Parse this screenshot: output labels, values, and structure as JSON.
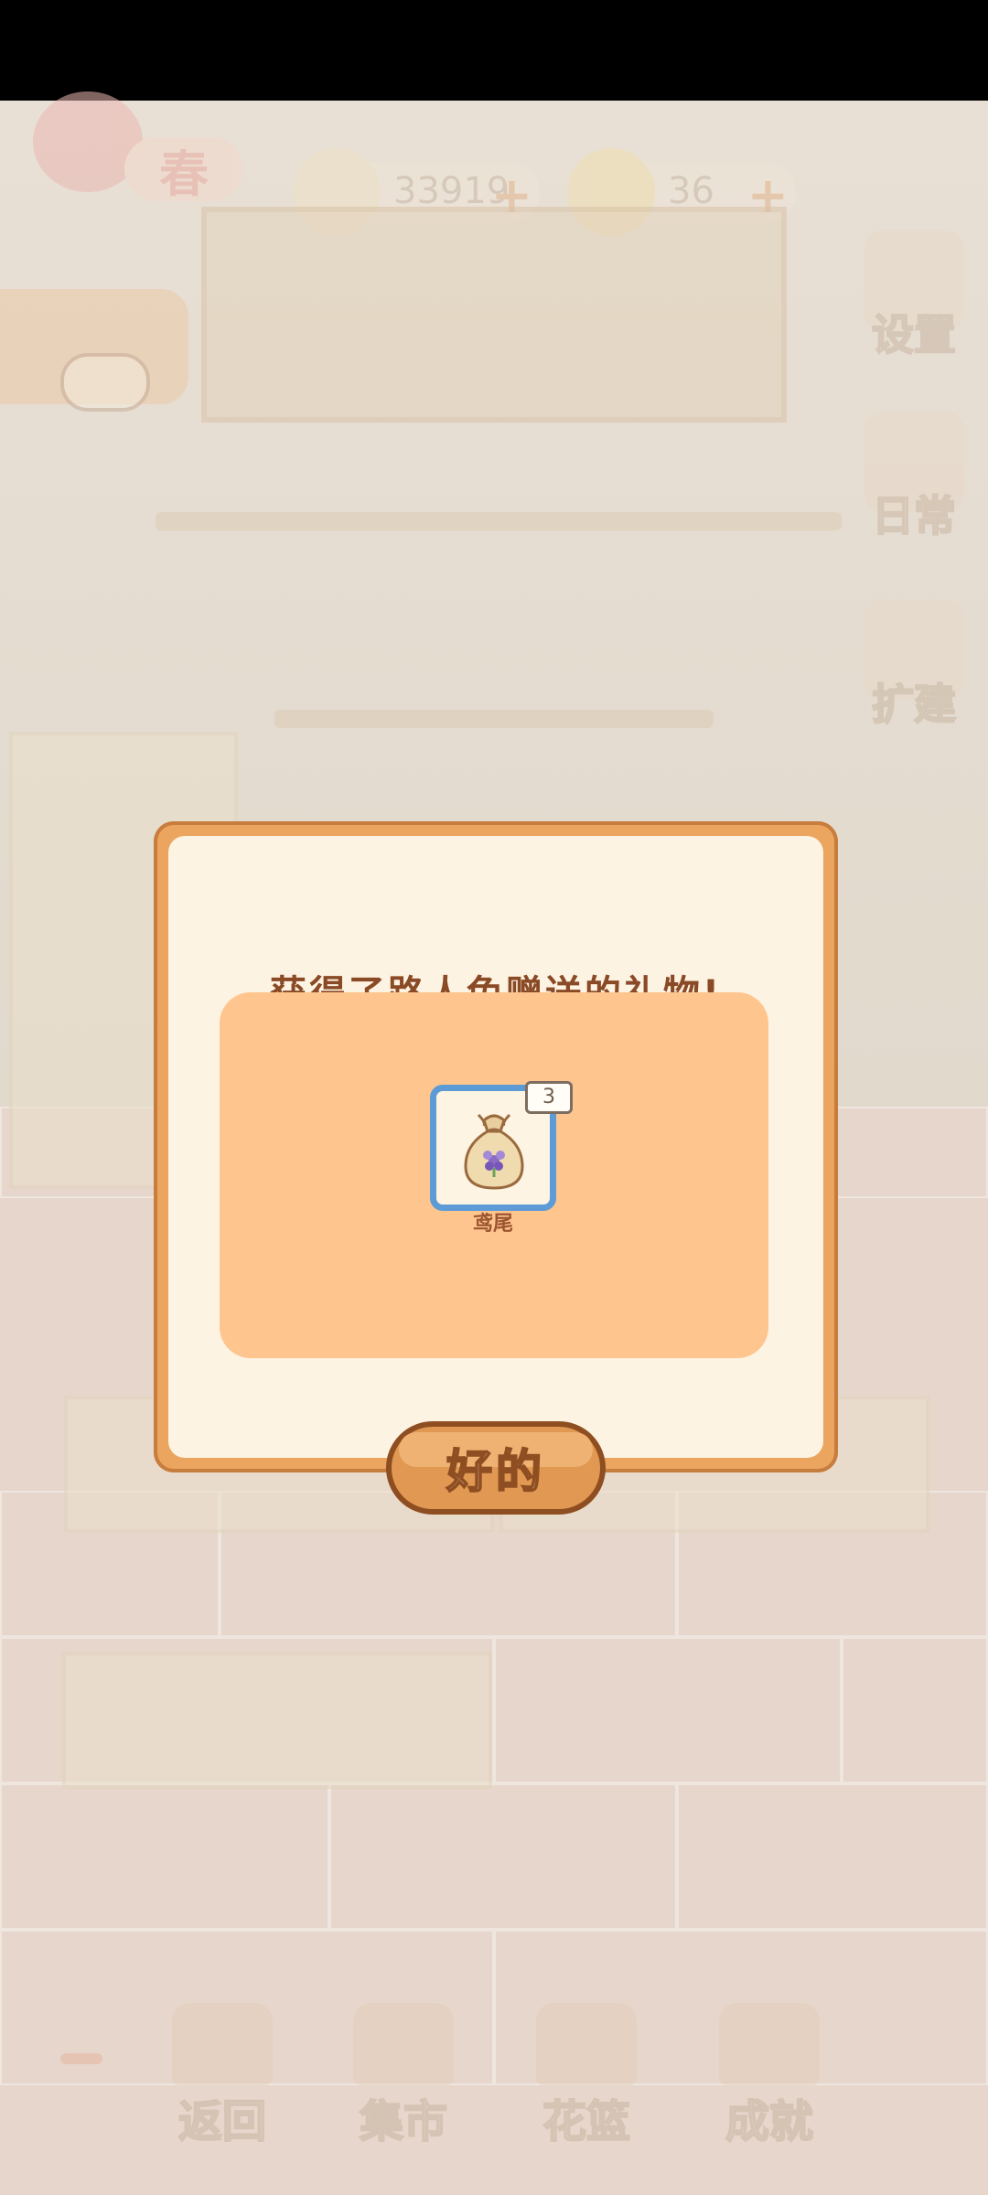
{
  "season": {
    "label": "春"
  },
  "currency": {
    "fish": {
      "value": "33919",
      "icon": "fish-bone-icon"
    },
    "cheese": {
      "value": "36",
      "icon": "cheese-icon"
    }
  },
  "side_buttons": [
    {
      "label": "设置",
      "icon": "gear-icon"
    },
    {
      "label": "日常",
      "icon": "tips-paper-icon"
    },
    {
      "label": "扩建",
      "icon": "hammer-icon"
    }
  ],
  "dialog": {
    "title": "获得了路人兔赠送的礼物!",
    "reward": {
      "name": "鸢尾",
      "count": "3",
      "icon": "seed-bag-icon"
    },
    "ok_label": "好的"
  },
  "bottom_nav": [
    {
      "label": "返回",
      "icon": "window-icon"
    },
    {
      "label": "集市",
      "icon": "market-stall-icon"
    },
    {
      "label": "花篮",
      "icon": "flower-basket-icon"
    },
    {
      "label": "成就",
      "icon": "trophy-icon"
    }
  ],
  "colors": {
    "dialog_border": "#eba55f",
    "dialog_bg": "#fdf3e2",
    "panel": "#ffc58e",
    "title_text": "#8a4a26",
    "item_border": "#5d9bd7"
  }
}
